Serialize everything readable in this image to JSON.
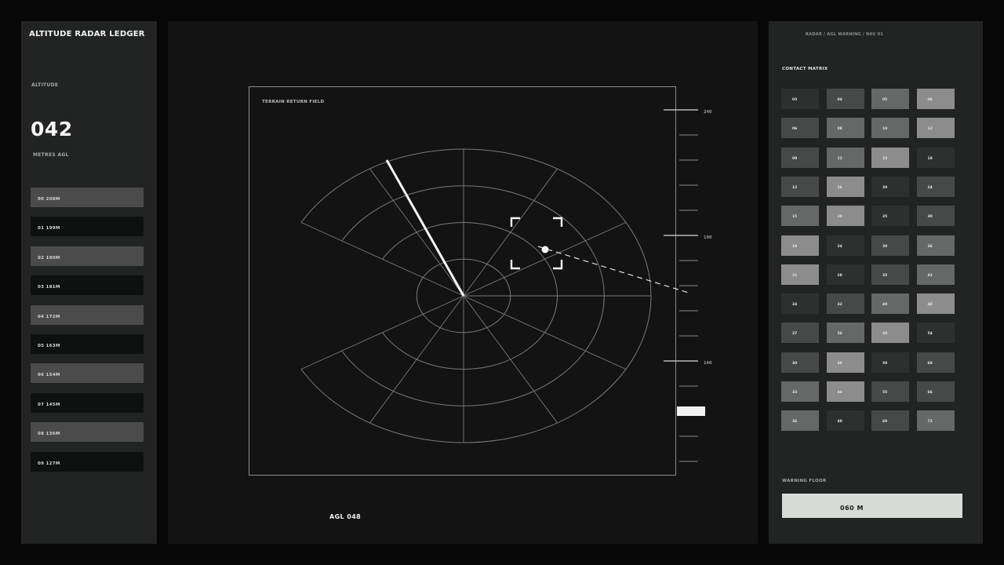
{
  "app": {
    "title": "ALTITUDE RADAR LEDGER"
  },
  "altitude": {
    "label": "ALTITUDE",
    "value": "042",
    "unit": "METRES AGL"
  },
  "altitude_ledger": [
    {
      "label": "00 208M",
      "tone": "light"
    },
    {
      "label": "01 199M",
      "tone": "dark"
    },
    {
      "label": "02 190M",
      "tone": "light"
    },
    {
      "label": "03 181M",
      "tone": "dark"
    },
    {
      "label": "04 172M",
      "tone": "light"
    },
    {
      "label": "05 163M",
      "tone": "dark"
    },
    {
      "label": "06 154M",
      "tone": "light"
    },
    {
      "label": "07 145M",
      "tone": "dark"
    },
    {
      "label": "08 136M",
      "tone": "light"
    },
    {
      "label": "09 127M",
      "tone": "dark"
    }
  ],
  "radar": {
    "field_label": "TERRAIN RETURN FIELD",
    "agl_readout": "AGL 048",
    "scale_labels": [
      "240",
      "190",
      "140"
    ],
    "sweep_bearing_deg": -28,
    "contact": {
      "range_fraction": 0.5,
      "bearing_deg": 70
    }
  },
  "right": {
    "breadcrumb": "RADAR / AGL WARNING / NAV 01",
    "matrix_title": "CONTACT MATRIX",
    "warning_label": "WARNING FLOOR",
    "warning_value": "060 M"
  },
  "contact_matrix": [
    [
      {
        "v": "03",
        "t": 1
      },
      {
        "v": "04",
        "t": 2
      },
      {
        "v": "05",
        "t": 3
      },
      {
        "v": "06",
        "t": 4
      }
    ],
    [
      {
        "v": "06",
        "t": 2
      },
      {
        "v": "08",
        "t": 3
      },
      {
        "v": "10",
        "t": 3
      },
      {
        "v": "12",
        "t": 4
      }
    ],
    [
      {
        "v": "09",
        "t": 2
      },
      {
        "v": "12",
        "t": 3
      },
      {
        "v": "15",
        "t": 4
      },
      {
        "v": "18",
        "t": 1
      }
    ],
    [
      {
        "v": "12",
        "t": 2
      },
      {
        "v": "16",
        "t": 4
      },
      {
        "v": "20",
        "t": 1
      },
      {
        "v": "24",
        "t": 2
      }
    ],
    [
      {
        "v": "15",
        "t": 3
      },
      {
        "v": "20",
        "t": 4
      },
      {
        "v": "25",
        "t": 1
      },
      {
        "v": "30",
        "t": 2
      }
    ],
    [
      {
        "v": "18",
        "t": 4
      },
      {
        "v": "24",
        "t": 1
      },
      {
        "v": "30",
        "t": 2
      },
      {
        "v": "36",
        "t": 3
      }
    ],
    [
      {
        "v": "21",
        "t": 4
      },
      {
        "v": "28",
        "t": 1
      },
      {
        "v": "35",
        "t": 2
      },
      {
        "v": "42",
        "t": 3
      }
    ],
    [
      {
        "v": "24",
        "t": 1
      },
      {
        "v": "32",
        "t": 2
      },
      {
        "v": "40",
        "t": 3
      },
      {
        "v": "48",
        "t": 4
      }
    ],
    [
      {
        "v": "27",
        "t": 2
      },
      {
        "v": "36",
        "t": 3
      },
      {
        "v": "45",
        "t": 4
      },
      {
        "v": "54",
        "t": 1
      }
    ],
    [
      {
        "v": "30",
        "t": 2
      },
      {
        "v": "40",
        "t": 4
      },
      {
        "v": "50",
        "t": 1
      },
      {
        "v": "60",
        "t": 2
      }
    ],
    [
      {
        "v": "33",
        "t": 3
      },
      {
        "v": "44",
        "t": 4
      },
      {
        "v": "55",
        "t": 2
      },
      {
        "v": "66",
        "t": 2
      }
    ],
    [
      {
        "v": "36",
        "t": 3
      },
      {
        "v": "48",
        "t": 1
      },
      {
        "v": "60",
        "t": 2
      },
      {
        "v": "72",
        "t": 3
      }
    ]
  ]
}
